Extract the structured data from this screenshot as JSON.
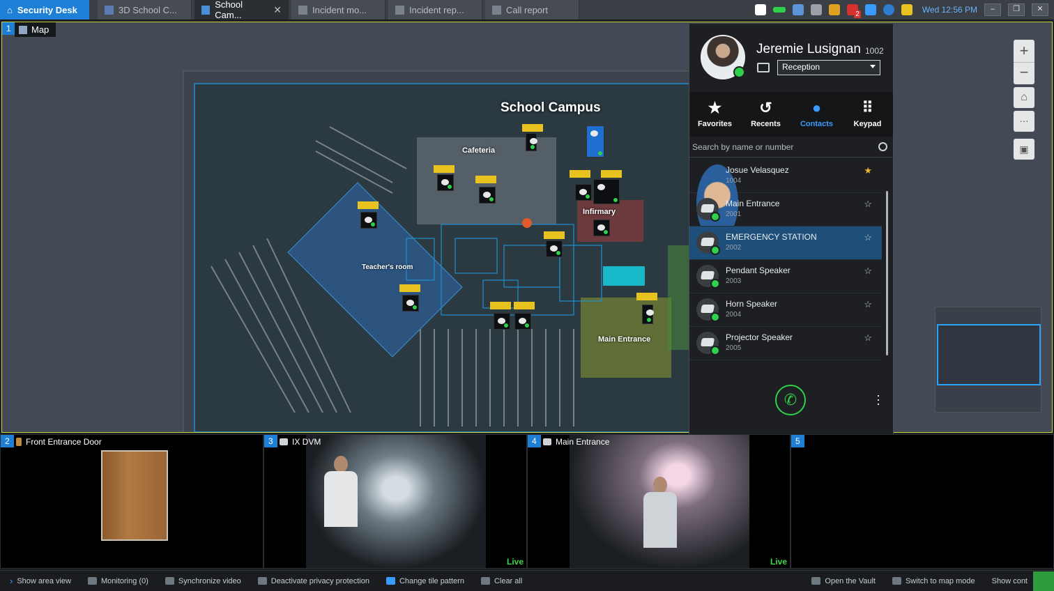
{
  "tabs": [
    {
      "label": "Security Desk",
      "type": "home"
    },
    {
      "label": "3D School C...",
      "type": "inactive"
    },
    {
      "label": "School Cam...",
      "type": "active"
    },
    {
      "label": "Incident mo...",
      "type": "inactive"
    },
    {
      "label": "Incident rep...",
      "type": "inactive"
    },
    {
      "label": "Call report",
      "type": "inactive"
    }
  ],
  "tray": {
    "badge_count": "2",
    "clock": "Wed 12:56 PM"
  },
  "map_tile": {
    "number": "1",
    "label": "Map",
    "title": "School Campus",
    "areas": [
      "Cafeteria",
      "Infirmary",
      "Teacher's room",
      "Main Entrance"
    ]
  },
  "softphone": {
    "user_name": "Jeremie Lusignan",
    "user_ext": "1002",
    "device_select": "Reception",
    "tabs": [
      {
        "label": "Favorites",
        "icon": "star-icon"
      },
      {
        "label": "Recents",
        "icon": "history-icon"
      },
      {
        "label": "Contacts",
        "icon": "person-icon"
      },
      {
        "label": "Keypad",
        "icon": "keypad-icon"
      }
    ],
    "selected_tab": "Contacts",
    "search_placeholder": "Search by name or number",
    "contacts": [
      {
        "name": "Josue Velasquez",
        "ext": "1004",
        "favorite": true,
        "kind": "person",
        "status": "offline"
      },
      {
        "name": "Main Entrance",
        "ext": "2001",
        "favorite": false,
        "kind": "device",
        "status": "online"
      },
      {
        "name": "EMERGENCY STATION",
        "ext": "2002",
        "favorite": false,
        "kind": "device",
        "status": "online",
        "selected": true
      },
      {
        "name": "Pendant Speaker",
        "ext": "2003",
        "favorite": false,
        "kind": "device",
        "status": "online"
      },
      {
        "name": "Horn Speaker",
        "ext": "2004",
        "favorite": false,
        "kind": "device",
        "status": "online"
      },
      {
        "name": "Projector Speaker",
        "ext": "2005",
        "favorite": false,
        "kind": "device",
        "status": "online"
      }
    ]
  },
  "video_tiles": [
    {
      "number": "2",
      "label": "Front Entrance Door",
      "live": ""
    },
    {
      "number": "3",
      "label": "IX DVM",
      "live": "Live"
    },
    {
      "number": "4",
      "label": "Main Entrance",
      "live": "Live"
    },
    {
      "number": "5",
      "label": "",
      "live": ""
    }
  ],
  "bottom_bar": {
    "left": [
      {
        "label": "Show area view",
        "icon": "chevron-right-icon"
      },
      {
        "label": "Monitoring (0)",
        "icon": "monitoring-icon"
      },
      {
        "label": "Synchronize video",
        "icon": "sync-icon"
      },
      {
        "label": "Deactivate privacy protection",
        "icon": "privacy-icon"
      },
      {
        "label": "Change tile pattern",
        "icon": "tile-pattern-icon"
      },
      {
        "label": "Clear all",
        "icon": "clear-icon"
      }
    ],
    "right": [
      {
        "label": "Open the Vault",
        "icon": "vault-icon"
      },
      {
        "label": "Switch to map mode",
        "icon": "map-mode-icon"
      },
      {
        "label": "Show cont",
        "icon": ""
      }
    ]
  },
  "colors": {
    "accent": "#1e7fd6",
    "online": "#2fd04a",
    "live": "#3fd648",
    "selected_row": "#1e4f7a",
    "tile_border": "#c9d33a"
  }
}
